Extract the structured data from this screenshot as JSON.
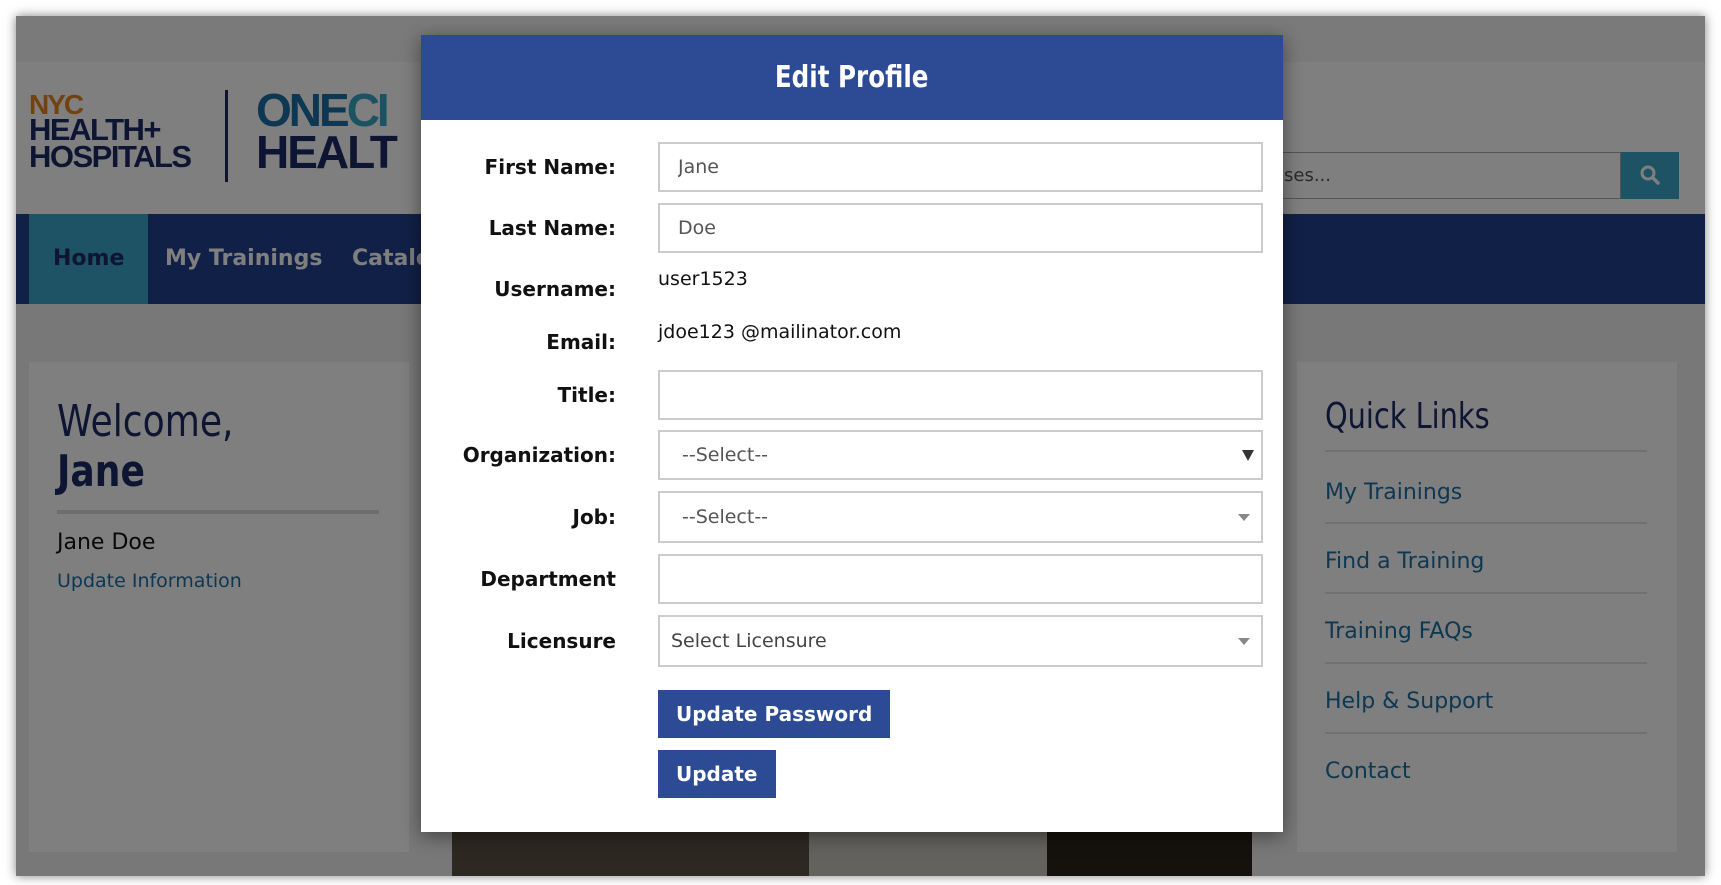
{
  "header": {
    "logo_nyc": "NYC",
    "logo_health": "HEALTH",
    "logo_plus": "+",
    "logo_hospitals": "HOSPITALS",
    "logo_one": "ONE",
    "logo_ci": "CI",
    "logo_health2": "HEALT",
    "search_placeholder": "ses..."
  },
  "nav": {
    "items": [
      {
        "label": "Home"
      },
      {
        "label": "My Trainings"
      },
      {
        "label": "Catalo"
      }
    ]
  },
  "welcome": {
    "line1": "Welcome,",
    "line2": "Jane",
    "name": "Jane Doe",
    "update_link": "Update Information"
  },
  "quick_links": {
    "title": "Quick Links",
    "links": [
      {
        "label": "My Trainings"
      },
      {
        "label": "Find a Training"
      },
      {
        "label": "Training FAQs"
      },
      {
        "label": "Help & Support"
      },
      {
        "label": "Contact"
      }
    ]
  },
  "modal": {
    "title": "Edit Profile",
    "first_name": {
      "label": "First Name:",
      "value": "Jane"
    },
    "last_name": {
      "label": "Last Name:",
      "value": "Doe"
    },
    "username": {
      "label": "Username:",
      "value": "user1523"
    },
    "email": {
      "label": "Email:",
      "value": "jdoe123 @mailinator.com"
    },
    "title_field": {
      "label": "Title:",
      "value": ""
    },
    "organization": {
      "label": "Organization:",
      "value": "--Select--"
    },
    "job": {
      "label": "Job:",
      "value": "--Select--"
    },
    "department": {
      "label": "Department",
      "value": ""
    },
    "licensure": {
      "label": "Licensure",
      "value": "Select Licensure"
    },
    "update_password_label": "Update Password",
    "update_label": "Update"
  },
  "colors": {
    "brand_blue": "#2d4a94",
    "nav_blue": "#23418f",
    "accent_teal": "#3ba7c9",
    "navy_text": "#1d2a66",
    "link_blue": "#1d6fa5",
    "nyc_orange": "#e8841c"
  }
}
